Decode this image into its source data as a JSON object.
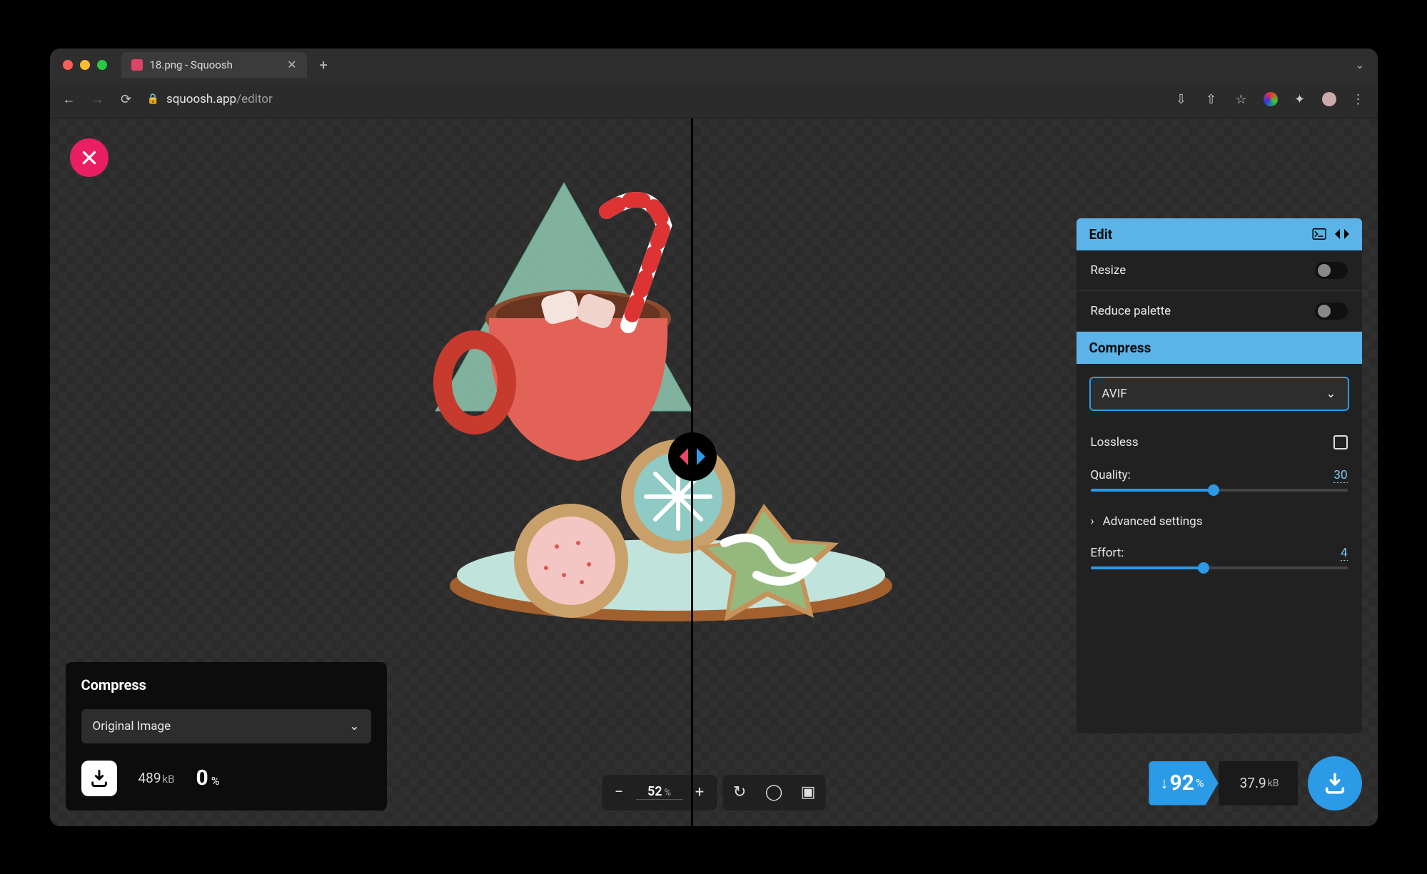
{
  "browser": {
    "tab_title": "18.png - Squoosh",
    "url_domain": "squoosh.app",
    "url_path": "/editor"
  },
  "left_panel": {
    "title": "Compress",
    "codec_selected": "Original Image",
    "file_size_value": "489",
    "file_size_unit": "kB",
    "savings_value": "0",
    "savings_unit": "%"
  },
  "right_panel": {
    "edit_title": "Edit",
    "resize_label": "Resize",
    "reduce_palette_label": "Reduce palette",
    "compress_title": "Compress",
    "codec_selected": "AVIF",
    "lossless_label": "Lossless",
    "quality_label": "Quality:",
    "quality_value": "30",
    "quality_max": 63,
    "advanced_label": "Advanced settings",
    "effort_label": "Effort:",
    "effort_value": "4",
    "effort_max": 9
  },
  "right_download": {
    "savings_value": "92",
    "savings_unit": "%",
    "file_size_value": "37.9",
    "file_size_unit": "kB"
  },
  "zoom": {
    "value": "52",
    "unit": "%"
  }
}
